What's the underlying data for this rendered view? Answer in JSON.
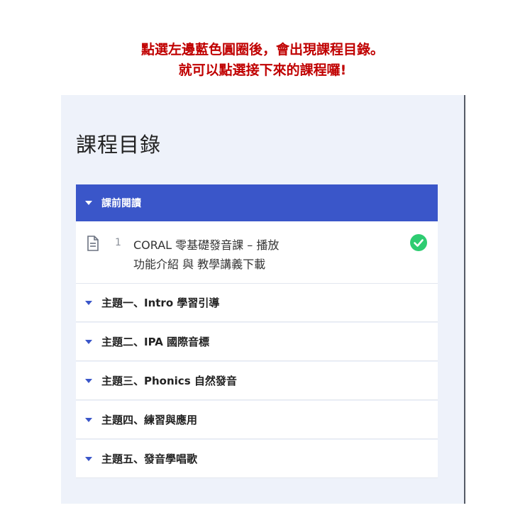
{
  "caption": {
    "line1": "點選左邊藍色圓圈後，會出現課程目錄。",
    "line2": "就可以點選接下來的課程囉!"
  },
  "toc": {
    "title": "課程目錄",
    "section": {
      "label": "課前閱讀",
      "expanded": true
    },
    "lesson": {
      "number": "1",
      "title_line1": "CORAL 零基礎發音課 – 播放",
      "title_line2": "功能介紹 與 教學講義下載",
      "icon": "document-icon",
      "status_icon": "check-circle-icon",
      "completed": true
    },
    "topics": [
      {
        "label": "主題一、Intro 學習引導"
      },
      {
        "label": "主題二、IPA 國際音標"
      },
      {
        "label": "主題三、Phonics 自然發音"
      },
      {
        "label": "主題四、練習與應用"
      },
      {
        "label": "主題五、發音學唱歌"
      }
    ]
  },
  "colors": {
    "caption": "#c00000",
    "accent": "#3a56c9",
    "panel_bg": "#eef2fa",
    "check": "#2ecc71"
  }
}
